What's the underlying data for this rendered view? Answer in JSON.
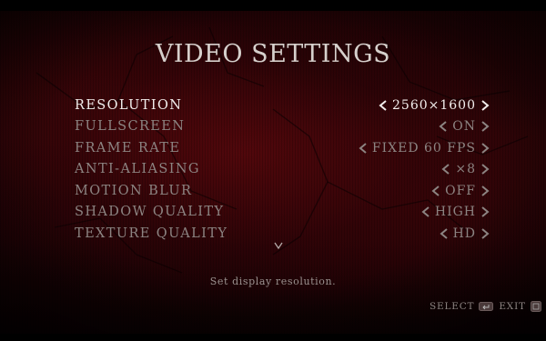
{
  "title": "VIDEO SETTINGS",
  "settings": [
    {
      "label": "RESOLUTION",
      "value": "2560×1600",
      "selected": true
    },
    {
      "label": "FULLSCREEN",
      "value": "ON",
      "selected": false
    },
    {
      "label": "FRAME RATE",
      "value": "FIXED 60 FPS",
      "selected": false
    },
    {
      "label": "ANTI-ALIASING",
      "value": "×8",
      "selected": false
    },
    {
      "label": "MOTION BLUR",
      "value": "OFF",
      "selected": false
    },
    {
      "label": "SHADOW QUALITY",
      "value": "HIGH",
      "selected": false
    },
    {
      "label": "TEXTURE QUALITY",
      "value": "HD",
      "selected": false
    }
  ],
  "description": "Set display resolution.",
  "controls": {
    "select_label": "SELECT",
    "exit_label": "EXIT"
  },
  "icons": {
    "left": "chevron-left-icon",
    "right": "chevron-right-icon",
    "more": "chevron-down-icon",
    "select_key": "enter-key-icon",
    "exit_key": "escape-key-icon"
  },
  "colors": {
    "selected_text": "#f2eeec",
    "normal_text": "#8c8482",
    "background": "#2a0407"
  }
}
